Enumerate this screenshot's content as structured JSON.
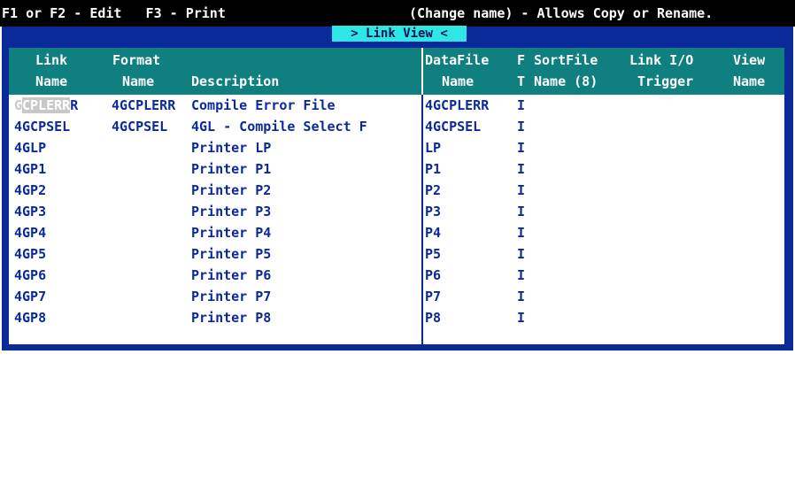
{
  "topbar": {
    "left_text": "F1 or F2 - Edit   F3 - Print",
    "right_text": "(Change name) - Allows Copy or Rename."
  },
  "window": {
    "title": "> Link View <"
  },
  "columns": {
    "link": [
      "Link",
      "Name"
    ],
    "format": [
      "Format",
      "Name"
    ],
    "description": [
      "",
      "Description"
    ],
    "datafile": [
      "DataFile",
      "Name"
    ],
    "ft": [
      "F",
      "T"
    ],
    "sortfile": [
      "SortFile",
      "Name (8)"
    ],
    "link_io": [
      "Link I/O",
      "Trigger"
    ],
    "view": [
      "View",
      "Name"
    ]
  },
  "rows": [
    {
      "link": "4GCPLERR",
      "format": "4GCPLERR",
      "description": "Compile Error File",
      "datafile": "4GCPLERR",
      "ft": "I"
    },
    {
      "link": "4GCPSEL",
      "format": "4GCPSEL",
      "description": "4GL - Compile Select F",
      "datafile": "4GCPSEL",
      "ft": "I"
    },
    {
      "link": "4GLP",
      "format": "",
      "description": "Printer LP",
      "datafile": "LP",
      "ft": "I"
    },
    {
      "link": "4GP1",
      "format": "",
      "description": "Printer P1",
      "datafile": "P1",
      "ft": "I"
    },
    {
      "link": "4GP2",
      "format": "",
      "description": "Printer P2",
      "datafile": "P2",
      "ft": "I"
    },
    {
      "link": "4GP3",
      "format": "",
      "description": "Printer P3",
      "datafile": "P3",
      "ft": "I"
    },
    {
      "link": "4GP4",
      "format": "",
      "description": "Printer P4",
      "datafile": "P4",
      "ft": "I"
    },
    {
      "link": "4GP5",
      "format": "",
      "description": "Printer P5",
      "datafile": "P5",
      "ft": "I"
    },
    {
      "link": "4GP6",
      "format": "",
      "description": "Printer P6",
      "datafile": "P6",
      "ft": "I"
    },
    {
      "link": "4GP7",
      "format": "",
      "description": "Printer P7",
      "datafile": "P7",
      "ft": "I"
    },
    {
      "link": "4GP8",
      "format": "",
      "description": "Printer P8",
      "datafile": "P8",
      "ft": "I"
    }
  ],
  "selected_row_link_display": [
    "G",
    "CPLERR",
    "R"
  ],
  "colors": {
    "frame": "#0b2a9a",
    "header": "#0f7f80",
    "title_tag": "#2ee6e6",
    "topbar": "#000000"
  }
}
